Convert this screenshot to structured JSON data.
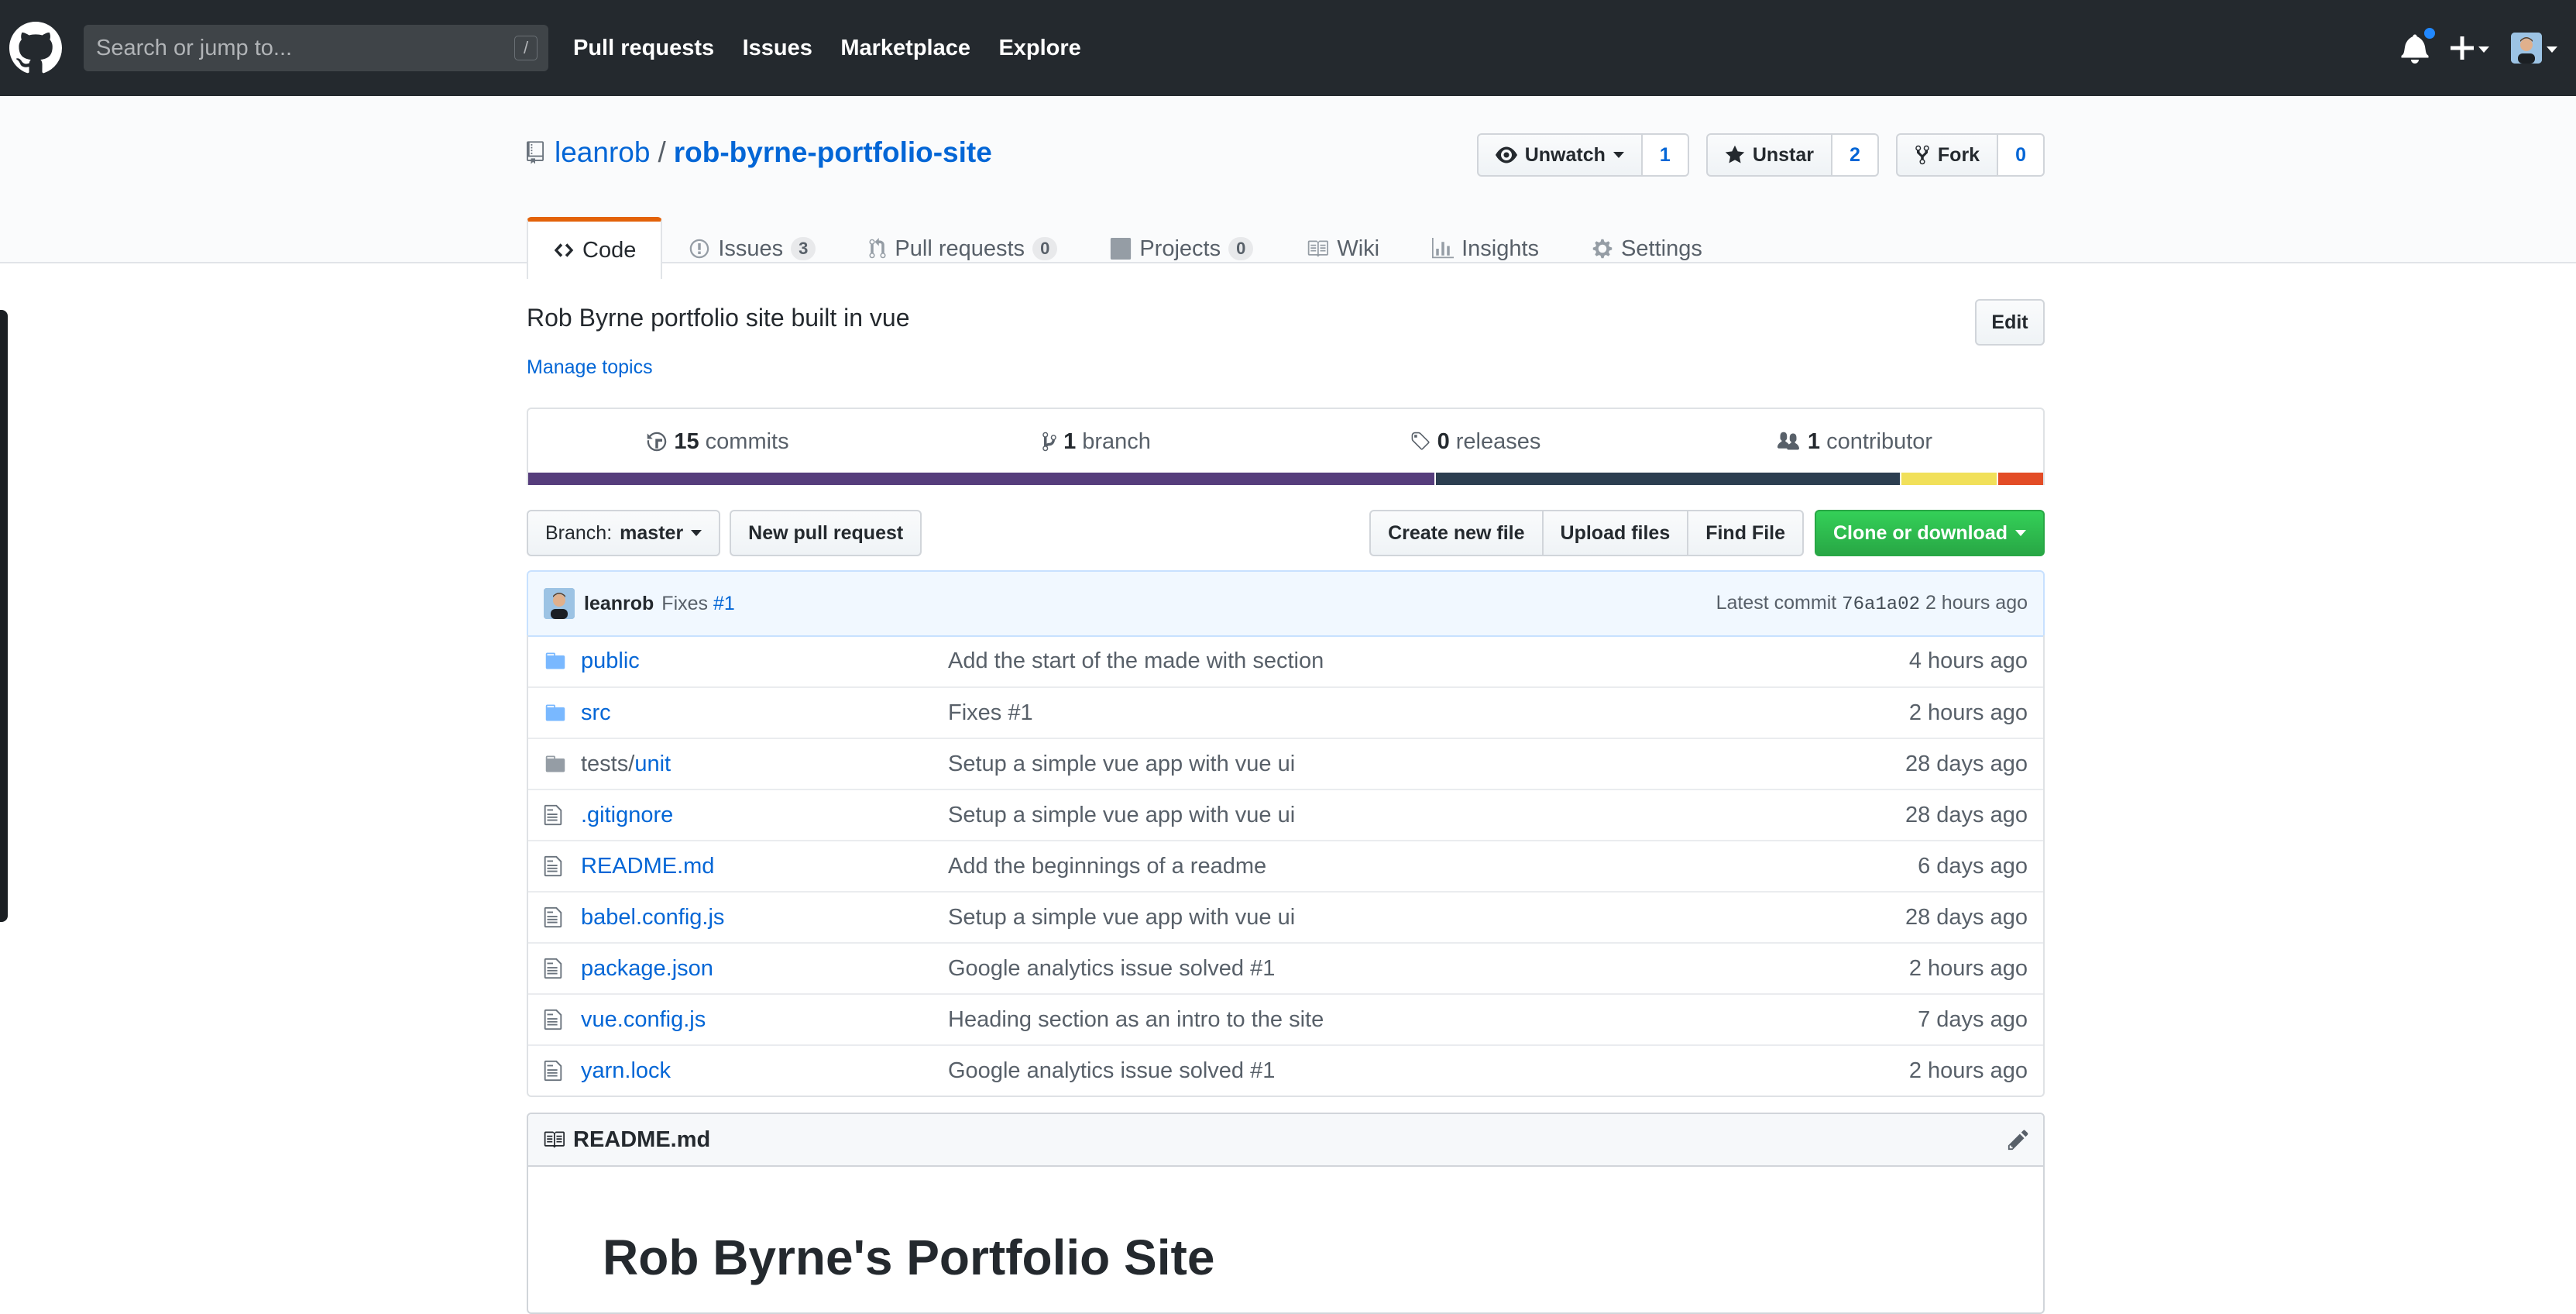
{
  "header": {
    "search_placeholder": "Search or jump to...",
    "search_shortcut": "/",
    "nav": [
      "Pull requests",
      "Issues",
      "Marketplace",
      "Explore"
    ]
  },
  "repo": {
    "owner": "leanrob",
    "separator": "/",
    "name": "rob-byrne-portfolio-site",
    "watch": {
      "label": "Unwatch",
      "count": "1"
    },
    "star": {
      "label": "Unstar",
      "count": "2"
    },
    "fork": {
      "label": "Fork",
      "count": "0"
    }
  },
  "tabs": [
    {
      "label": "Code",
      "badge": null,
      "icon": "code-icon"
    },
    {
      "label": "Issues",
      "badge": "3",
      "icon": "issue-icon"
    },
    {
      "label": "Pull requests",
      "badge": "0",
      "icon": "pull-request-icon"
    },
    {
      "label": "Projects",
      "badge": "0",
      "icon": "project-icon"
    },
    {
      "label": "Wiki",
      "badge": null,
      "icon": "book-icon"
    },
    {
      "label": "Insights",
      "badge": null,
      "icon": "graph-icon"
    },
    {
      "label": "Settings",
      "badge": null,
      "icon": "gear-icon"
    }
  ],
  "description": "Rob Byrne portfolio site built in vue",
  "edit_label": "Edit",
  "manage_topics": "Manage topics",
  "summary": {
    "commits": {
      "count": "15",
      "label": "commits"
    },
    "branches": {
      "count": "1",
      "label": "branch"
    },
    "releases": {
      "count": "0",
      "label": "releases"
    },
    "contributors": {
      "count": "1",
      "label": "contributor"
    }
  },
  "languages": [
    {
      "color": "#563d7c",
      "percent": 60
    },
    {
      "color": "#2c3e50",
      "percent": 30.7
    },
    {
      "color": "#f1e05a",
      "percent": 6.3
    },
    {
      "color": "#e34c26",
      "percent": 3
    }
  ],
  "file_nav": {
    "branch_prefix": "Branch:",
    "branch": "master",
    "new_pr": "New pull request",
    "create_file": "Create new file",
    "upload_files": "Upload files",
    "find_file": "Find File",
    "clone": "Clone or download"
  },
  "latest_commit": {
    "author": "leanrob",
    "message": "Fixes",
    "issue_ref": "#1",
    "label": "Latest commit",
    "sha": "76a1a02",
    "age": "2 hours ago"
  },
  "files": [
    {
      "type": "dir",
      "name": "public",
      "prefix": "",
      "message": "Add the start of the made with section",
      "age": "4 hours ago"
    },
    {
      "type": "dir",
      "name": "src",
      "prefix": "",
      "message": "Fixes #1",
      "age": "2 hours ago"
    },
    {
      "type": "dir",
      "name": "unit",
      "prefix": "tests/",
      "message": "Setup a simple vue app with vue ui",
      "age": "28 days ago"
    },
    {
      "type": "file",
      "name": ".gitignore",
      "prefix": "",
      "message": "Setup a simple vue app with vue ui",
      "age": "28 days ago"
    },
    {
      "type": "file",
      "name": "README.md",
      "prefix": "",
      "message": "Add the beginnings of a readme",
      "age": "6 days ago"
    },
    {
      "type": "file",
      "name": "babel.config.js",
      "prefix": "",
      "message": "Setup a simple vue app with vue ui",
      "age": "28 days ago"
    },
    {
      "type": "file",
      "name": "package.json",
      "prefix": "",
      "message": "Google analytics issue solved #1",
      "age": "2 hours ago"
    },
    {
      "type": "file",
      "name": "vue.config.js",
      "prefix": "",
      "message": "Heading section as an intro to the site",
      "age": "7 days ago"
    },
    {
      "type": "file",
      "name": "yarn.lock",
      "prefix": "",
      "message": "Google analytics issue solved #1",
      "age": "2 hours ago"
    }
  ],
  "readme": {
    "filename": "README.md",
    "heading": "Rob Byrne's Portfolio Site"
  }
}
